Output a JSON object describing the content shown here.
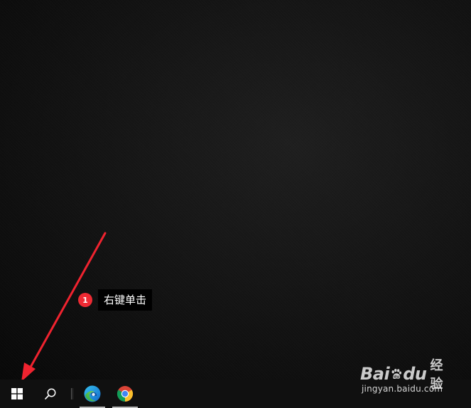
{
  "annotation": {
    "step_number": "1",
    "instruction": "右键单击",
    "badge_color": "#ee2a33",
    "arrow_color": "#f0232f"
  },
  "taskbar": {
    "items": [
      {
        "name": "start-button",
        "icon": "windows-logo-icon"
      },
      {
        "name": "search-button",
        "icon": "search-icon"
      },
      {
        "name": "edge-app",
        "icon": "edge-icon",
        "running": true
      },
      {
        "name": "chrome-app",
        "icon": "chrome-icon",
        "running": true
      }
    ]
  },
  "watermark": {
    "logo_left": "Bai",
    "logo_right": "du",
    "product": "经验",
    "url": "jingyan.baidu.com"
  }
}
